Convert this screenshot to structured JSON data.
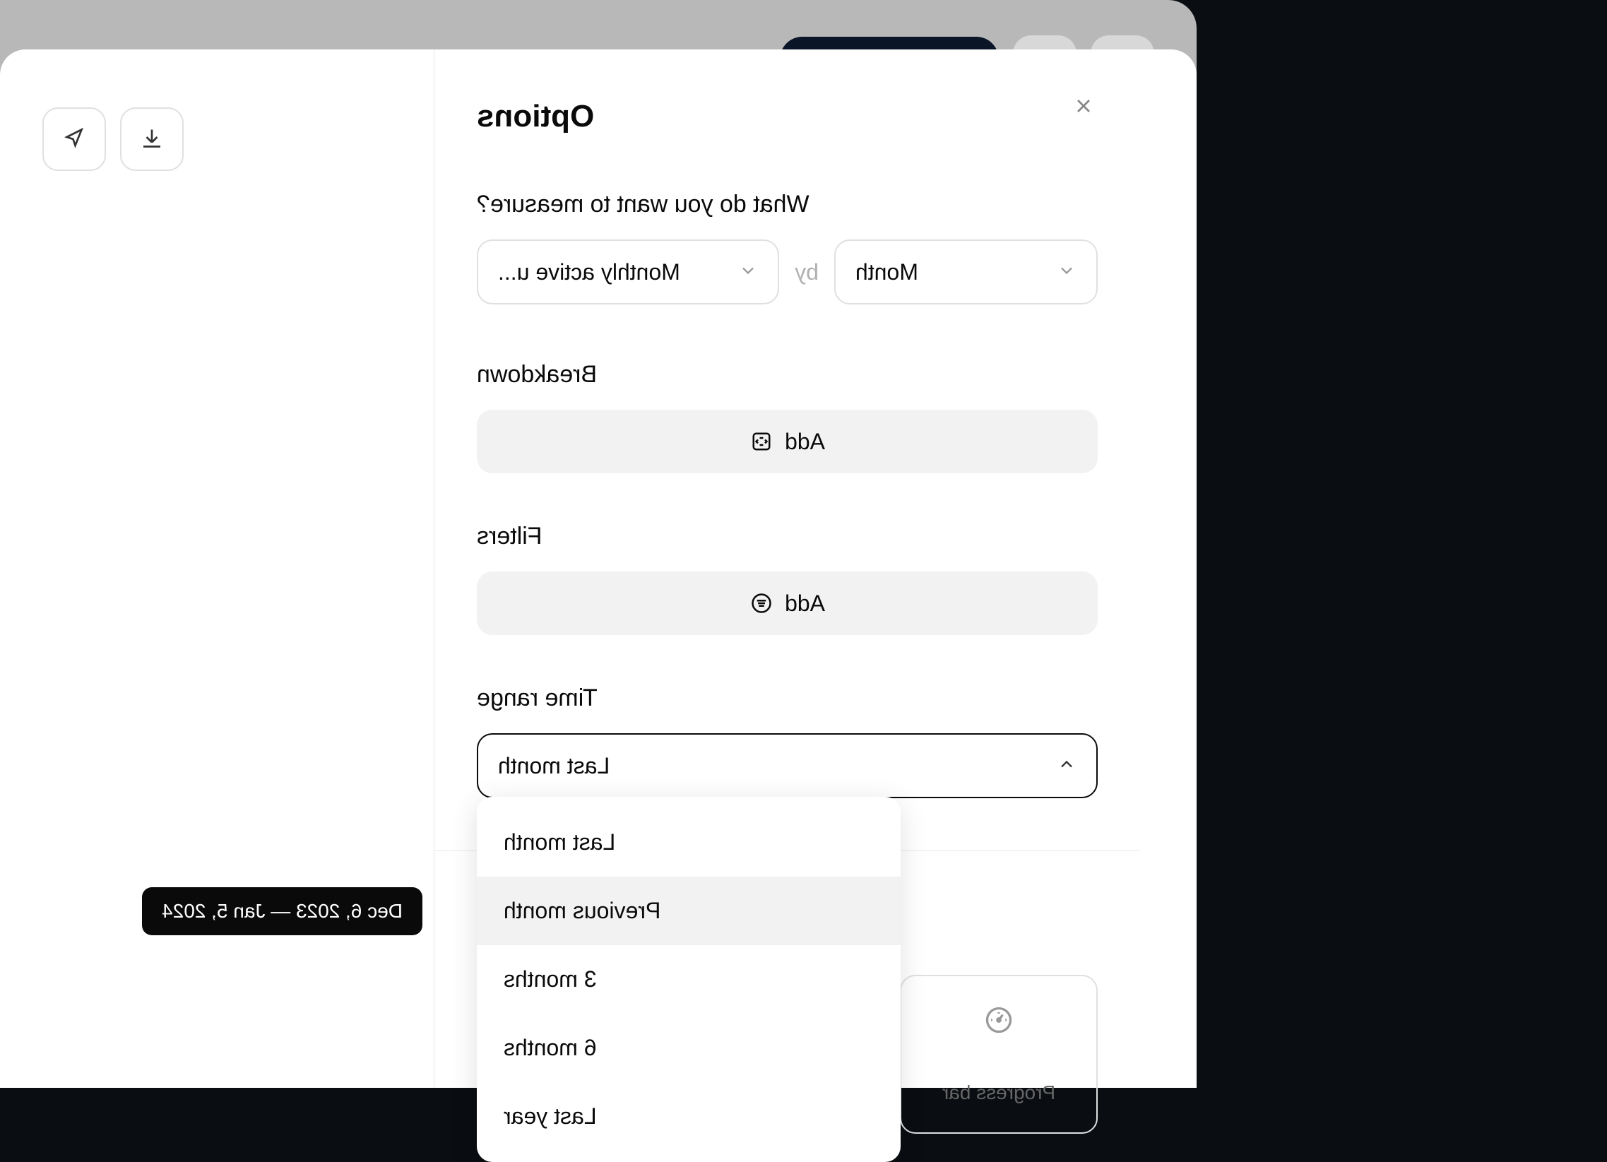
{
  "panel": {
    "title": "Options",
    "measure": {
      "question": "What do you want to measure?",
      "metric": "Monthly active u...",
      "by_label": "by",
      "interval": "Month"
    },
    "breakdown": {
      "label": "Breakdown",
      "add_label": "Add"
    },
    "filters": {
      "label": "Filters",
      "add_label": "Add"
    },
    "time_range": {
      "label": "Time range",
      "selected": "Last month",
      "options": [
        "Last month",
        "Previous month",
        "3 months",
        "6 months",
        "Last year"
      ]
    }
  },
  "tooltip": "Dec 6, 2023 — Jan 5, 2024",
  "progress_card": {
    "label": "Progress bar"
  }
}
